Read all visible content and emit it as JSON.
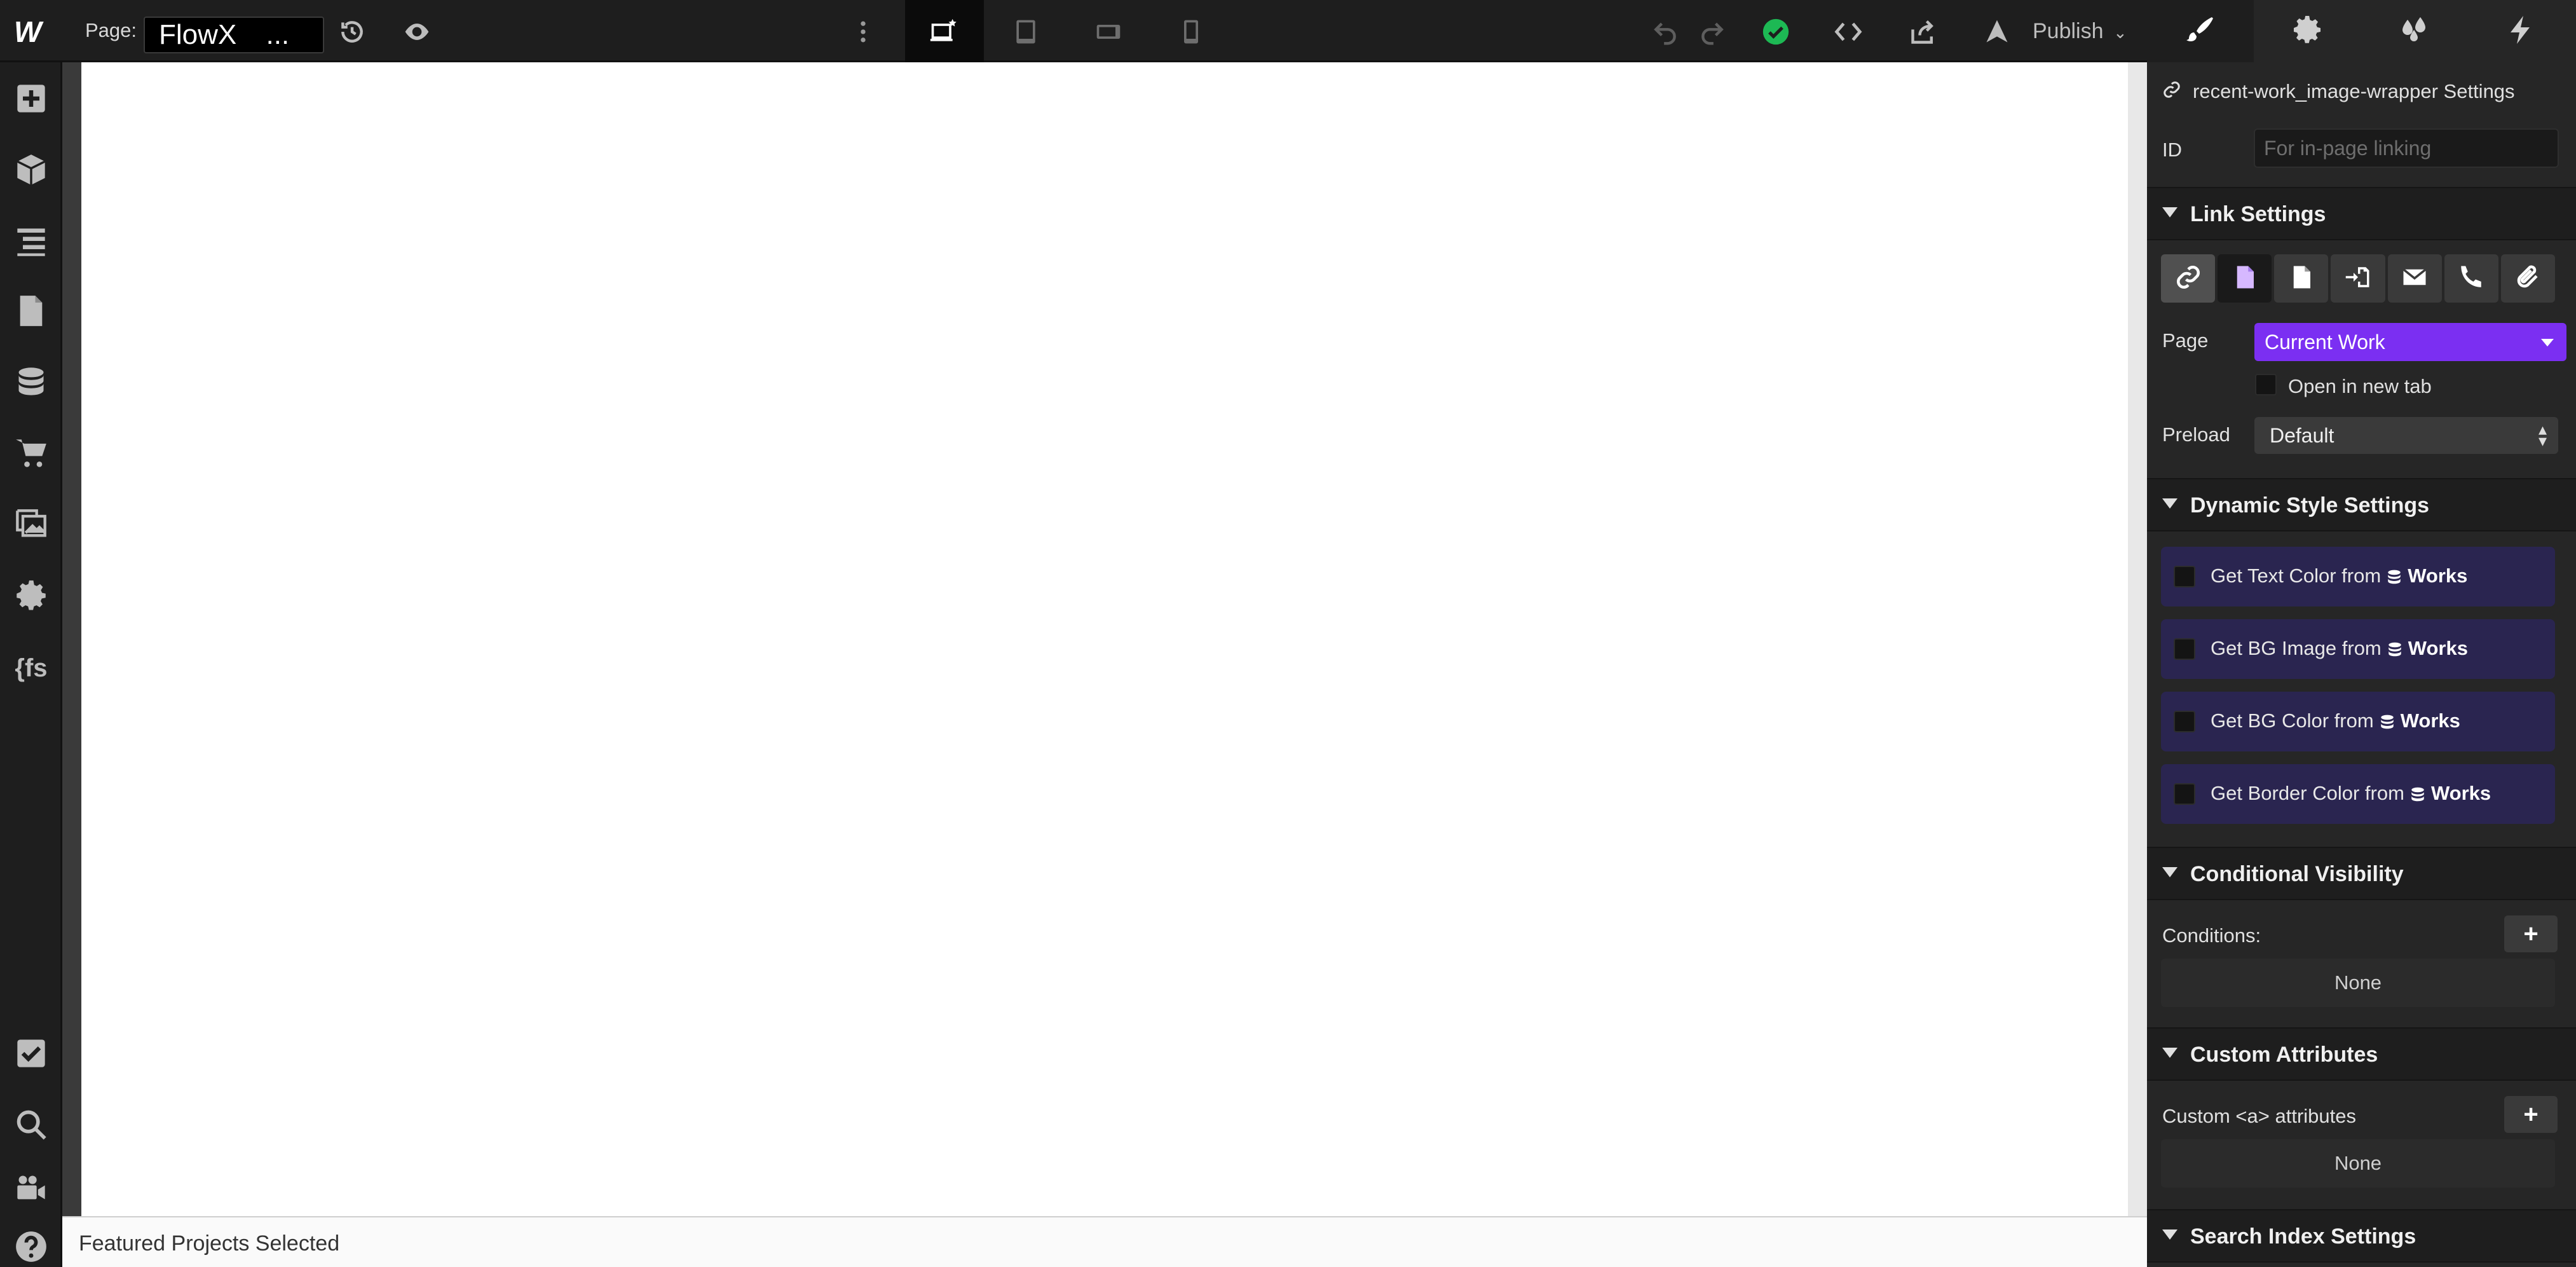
{
  "app": {
    "logo": "W",
    "page_label": "Page:",
    "page_name": "FlowX",
    "page_more": "...",
    "publish_label": "Publish"
  },
  "canvas": {
    "status_text": "Featured Projects Selected"
  },
  "left_sidebar": {
    "fs_label": "{fs"
  },
  "panel": {
    "element_title": "recent-work_image-wrapper Settings",
    "id_label": "ID",
    "id_placeholder": "For in-page linking",
    "link_settings": {
      "title": "Link Settings",
      "page_label": "Page",
      "page_value": "Current Work",
      "open_new_tab": "Open in new tab",
      "preload_label": "Preload",
      "preload_value": "Default"
    },
    "dynamic_style": {
      "title": "Dynamic Style Settings",
      "items": [
        {
          "label": "Get Text Color from",
          "source": "Works"
        },
        {
          "label": "Get BG Image from",
          "source": "Works"
        },
        {
          "label": "Get BG Color from",
          "source": "Works"
        },
        {
          "label": "Get Border Color from",
          "source": "Works"
        }
      ]
    },
    "conditional_visibility": {
      "title": "Conditional Visibility",
      "conditions_label": "Conditions:",
      "none": "None"
    },
    "custom_attributes": {
      "title": "Custom Attributes",
      "label": "Custom <a> attributes",
      "none": "None"
    },
    "search_index": {
      "title": "Search Index Settings"
    }
  },
  "colors": {
    "accent_purple": "#7b2ff2",
    "success_green": "#1db954",
    "dynamic_bg": "#2a2550"
  }
}
